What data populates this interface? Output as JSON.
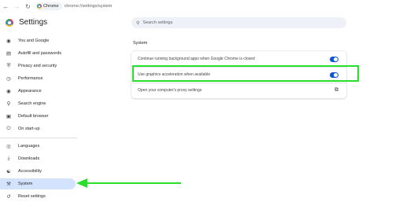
{
  "browser": {
    "chip_label": "Chrome",
    "url": "chrome://settings/system",
    "icons": [
      "back-arrow-icon",
      "forward-arrow-icon",
      "reload-icon",
      "chrome-icon"
    ]
  },
  "header": {
    "title": "Settings",
    "search_placeholder": "Search settings"
  },
  "sidebar": {
    "items": [
      {
        "label": "You and Google",
        "icon": "chrome-g-icon"
      },
      {
        "label": "Autofill and passwords",
        "icon": "clipboard-icon"
      },
      {
        "label": "Privacy and security",
        "icon": "shield-icon"
      },
      {
        "label": "Performance",
        "icon": "speedometer-icon"
      },
      {
        "label": "Appearance",
        "icon": "palette-icon"
      },
      {
        "label": "Search engine",
        "icon": "search-icon"
      },
      {
        "label": "Default browser",
        "icon": "browser-icon"
      },
      {
        "label": "On start-up",
        "icon": "power-icon"
      },
      {
        "label": "Languages",
        "icon": "globe-icon"
      },
      {
        "label": "Downloads",
        "icon": "download-icon"
      },
      {
        "label": "Accessibility",
        "icon": "accessibility-icon"
      },
      {
        "label": "System",
        "icon": "wrench-icon"
      },
      {
        "label": "Reset settings",
        "icon": "reset-icon"
      }
    ],
    "active": "System"
  },
  "main": {
    "section_title": "System",
    "rows": [
      {
        "label": "Continue running background apps when Google Chrome is closed",
        "control": "toggle",
        "state": "on"
      },
      {
        "label": "Use graphics acceleration when available",
        "control": "toggle",
        "state": "on"
      },
      {
        "label": "Open your computer's proxy settings",
        "control": "external-link-icon"
      }
    ]
  },
  "colors": {
    "accent": "#0b57d0",
    "active_bg": "#d3e3fd",
    "annotation": "#28e02c"
  }
}
